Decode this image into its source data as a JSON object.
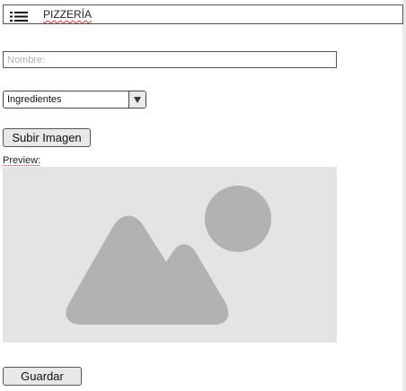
{
  "header": {
    "title": "PIZZERÍA",
    "menu_icon": "hamburger-menu-icon"
  },
  "form": {
    "name_placeholder": "Nombre:",
    "name_value": "",
    "ingredients_selected": "Ingredientes",
    "upload_label": "Subir Imagen",
    "preview_label": "Preview:",
    "image_icon": "image-placeholder-icon",
    "save_label": "Guardar"
  },
  "colors": {
    "placeholder_bg": "#e4e4e4",
    "placeholder_shape": "#b2b2b2",
    "button_bg": "#e8e8e8",
    "border": "#555555"
  }
}
